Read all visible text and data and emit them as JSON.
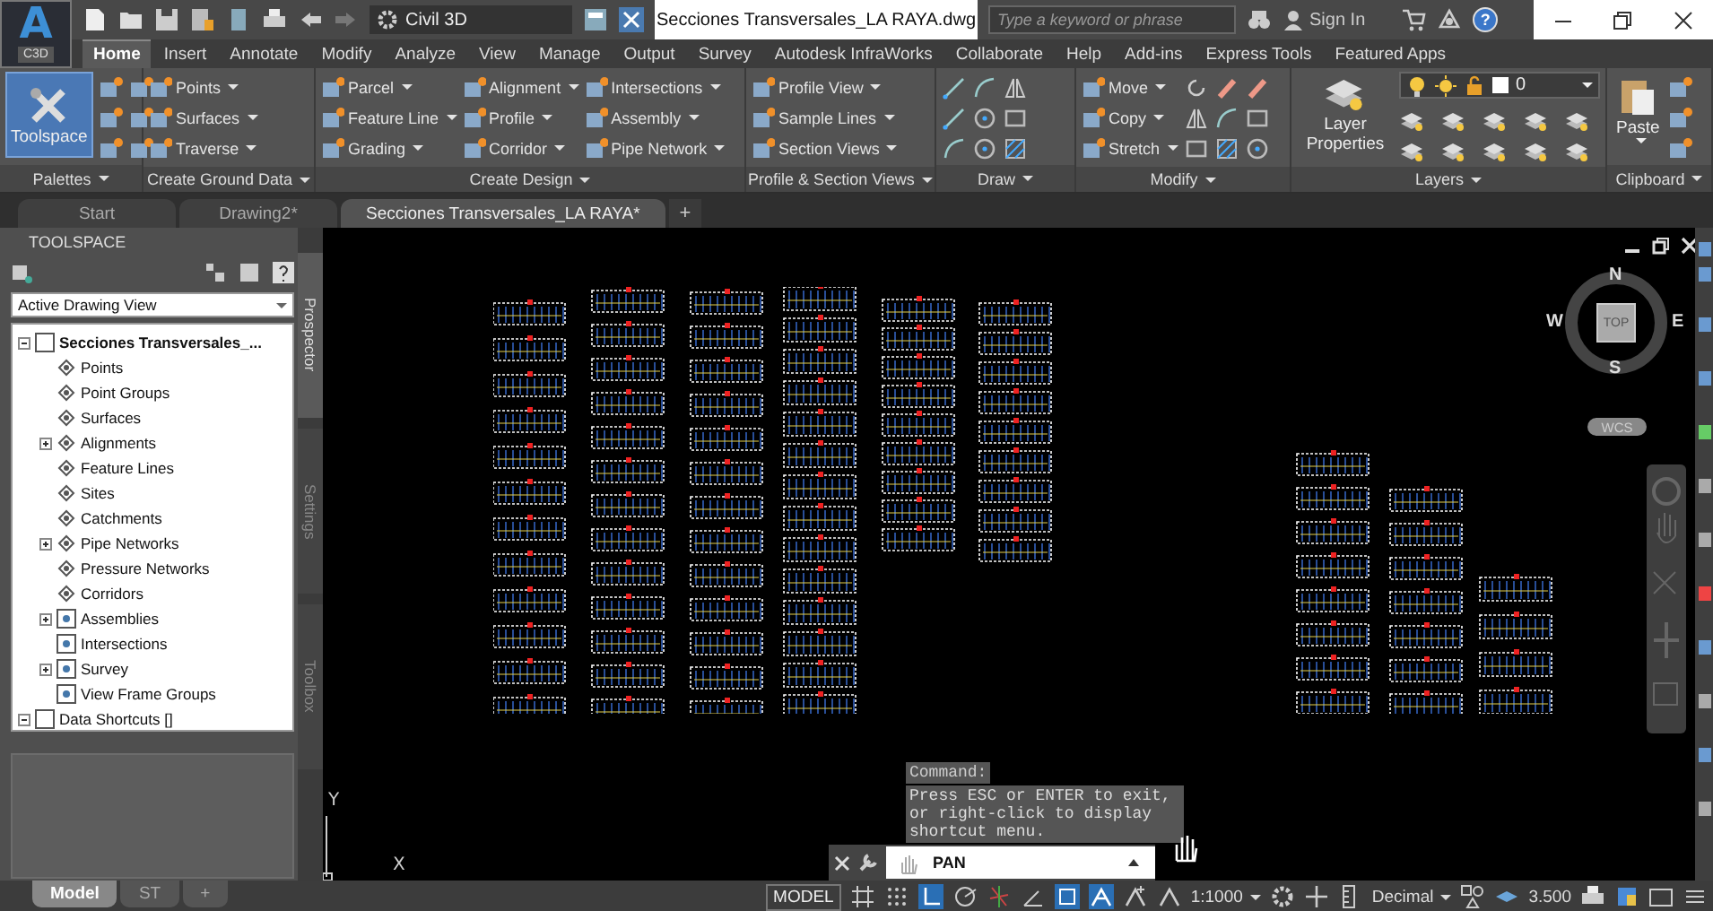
{
  "app_menu": {
    "letter": "A",
    "badge": "C3D"
  },
  "workspace": "Civil 3D",
  "window": {
    "title": "Secciones Transversales_LA RAYA.dwg"
  },
  "search": {
    "placeholder": "Type a keyword or phrase"
  },
  "account": {
    "label": "Sign In"
  },
  "help": {
    "label": "?"
  },
  "ribbon_tabs": [
    {
      "label": "Home",
      "selected": true
    },
    {
      "label": "Insert",
      "selected": false
    },
    {
      "label": "Annotate",
      "selected": false
    },
    {
      "label": "Modify",
      "selected": false
    },
    {
      "label": "Analyze",
      "selected": false
    },
    {
      "label": "View",
      "selected": false
    },
    {
      "label": "Manage",
      "selected": false
    },
    {
      "label": "Output",
      "selected": false
    },
    {
      "label": "Survey",
      "selected": false
    },
    {
      "label": "Autodesk InfraWorks",
      "selected": false
    },
    {
      "label": "Collaborate",
      "selected": false
    },
    {
      "label": "Help",
      "selected": false
    },
    {
      "label": "Add-ins",
      "selected": false
    },
    {
      "label": "Express Tools",
      "selected": false
    },
    {
      "label": "Featured Apps",
      "selected": false
    }
  ],
  "ribbon_panels": [
    {
      "kind": "palettes",
      "title": "Palettes",
      "button": "Toolspace"
    },
    {
      "kind": "commands",
      "title": "Create Ground Data",
      "columns": [
        [
          "Points",
          "Surfaces",
          "Traverse"
        ]
      ]
    },
    {
      "kind": "commands",
      "title": "Create Design",
      "columns": [
        [
          "Parcel",
          "Feature Line",
          "Grading"
        ],
        [
          "Alignment",
          "Profile",
          "Corridor"
        ],
        [
          "Intersections",
          "Assembly",
          "Pipe Network"
        ]
      ]
    },
    {
      "kind": "commands",
      "title": "Profile & Section Views",
      "columns": [
        [
          "Profile View",
          "Sample Lines",
          "Section Views"
        ]
      ]
    },
    {
      "kind": "tools",
      "title": "Draw"
    },
    {
      "kind": "commands",
      "title": "Modify",
      "columns": [
        [
          "Move",
          "Copy",
          "Stretch"
        ]
      ],
      "icon_grid": true
    },
    {
      "kind": "layers",
      "title": "Layers",
      "button": "Layer Properties",
      "layer": "0"
    },
    {
      "kind": "clipboard",
      "title": "Clipboard",
      "button": "Paste"
    }
  ],
  "document_tabs": [
    {
      "label": "Start",
      "selected": false
    },
    {
      "label": "Drawing2*",
      "selected": false
    },
    {
      "label": "Secciones Transversales_LA RAYA*",
      "selected": true
    }
  ],
  "new_tab": "+",
  "toolspace": {
    "title": "TOOLSPACE",
    "view": "Active Drawing View",
    "tree": [
      {
        "label": "Secciones Transversales_...",
        "kind": "group",
        "expanded": true,
        "children": [
          {
            "label": "Points",
            "kind": "leaf"
          },
          {
            "label": "Point Groups",
            "kind": "leaf"
          },
          {
            "label": "Surfaces",
            "kind": "leaf"
          },
          {
            "label": "Alignments",
            "kind": "group",
            "expanded": false
          },
          {
            "label": "Feature Lines",
            "kind": "leaf"
          },
          {
            "label": "Sites",
            "kind": "leaf"
          },
          {
            "label": "Catchments",
            "kind": "leaf"
          },
          {
            "label": "Pipe Networks",
            "kind": "group",
            "expanded": false
          },
          {
            "label": "Pressure Networks",
            "kind": "leaf"
          },
          {
            "label": "Corridors",
            "kind": "leaf"
          },
          {
            "label": "Assemblies",
            "kind": "group",
            "expanded": false
          },
          {
            "label": "Intersections",
            "kind": "leaf"
          },
          {
            "label": "Survey",
            "kind": "group",
            "expanded": false
          },
          {
            "label": "View Frame Groups",
            "kind": "leaf"
          }
        ]
      },
      {
        "label": "Data Shortcuts []",
        "kind": "group",
        "expanded": true
      }
    ],
    "side_tabs": [
      {
        "label": "Prospector",
        "selected": true
      },
      {
        "label": "Settings",
        "selected": false
      },
      {
        "label": "Toolbox",
        "selected": false
      }
    ]
  },
  "viewcube": {
    "north": "N",
    "south": "S",
    "east": "E",
    "west": "W",
    "face": "TOP",
    "ucs": "WCS"
  },
  "ucs_icon": {
    "y": "Y",
    "x": "X"
  },
  "command": {
    "prompt": "Command:",
    "message": "Press ESC or ENTER to exit, or right-click to display shortcut menu.",
    "value": "PAN"
  },
  "layout_tabs": [
    {
      "label": "Model",
      "selected": true
    },
    {
      "label": "ST",
      "selected": false
    }
  ],
  "layout_add": "+",
  "status": {
    "space": "MODEL",
    "scale": "1:1000",
    "units": "Decimal",
    "value": "3.500"
  }
}
